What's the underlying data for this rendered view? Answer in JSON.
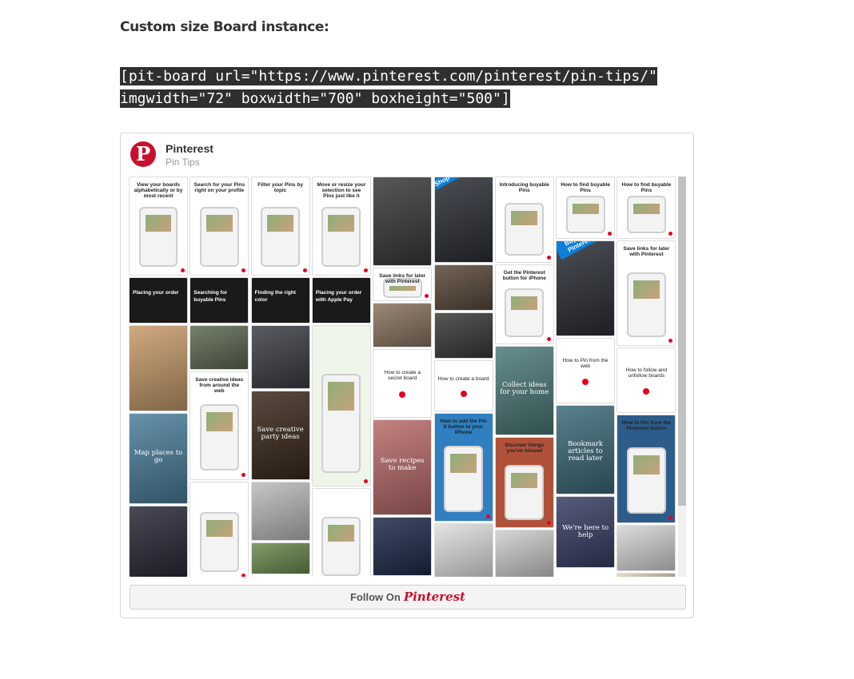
{
  "heading": "Custom size Board instance:",
  "shortcode": {
    "line1": "[pit-board url=\"https://www.pinterest.com/pinterest/pin-tips/\"",
    "line2": "imgwidth=\"72\" boxwidth=\"700\" boxheight=\"500\"]"
  },
  "board": {
    "logo_glyph": "P",
    "owner": "Pinterest",
    "name": "Pin Tips",
    "follow_prefix": "Follow On",
    "follow_brand": "Pinterest",
    "brand_color": "#c8102e"
  },
  "pins": [
    {
      "col": 0,
      "caption": "View your boards alphabetically or by most recent",
      "style": "phone",
      "bg": "#ffffff"
    },
    {
      "col": 0,
      "caption": "Placing your order",
      "style": "dark",
      "bg": "#1a1a1a"
    },
    {
      "col": 0,
      "caption": "",
      "style": "photo",
      "bg": "#c79b6a"
    },
    {
      "col": 0,
      "caption": "Map places to go",
      "style": "overlay",
      "bg": "#4b7f9c"
    },
    {
      "col": 0,
      "caption": "",
      "style": "photo",
      "bg": "#2a2a3a"
    },
    {
      "col": 1,
      "caption": "Search for your Pins right on your profile",
      "style": "phone",
      "bg": "#ffffff"
    },
    {
      "col": 1,
      "caption": "Searching for buyable Pins",
      "style": "dark",
      "bg": "#1a1a1a"
    },
    {
      "col": 1,
      "caption": "",
      "style": "photo",
      "bg": "#5e6b52"
    },
    {
      "col": 1,
      "caption": "Save creative ideas from around the web",
      "style": "phone",
      "bg": "#ffffff"
    },
    {
      "col": 1,
      "caption": "",
      "style": "phone",
      "bg": "#ffffff"
    },
    {
      "col": 2,
      "caption": "Filter your Pins by topic",
      "style": "phone",
      "bg": "#ffffff"
    },
    {
      "col": 2,
      "caption": "Finding the right color",
      "style": "dark",
      "bg": "#1a1a1a"
    },
    {
      "col": 2,
      "caption": "",
      "style": "photo",
      "bg": "#3c3f45"
    },
    {
      "col": 2,
      "caption": "Save creative party ideas",
      "style": "overlay",
      "bg": "#3b2a1d"
    },
    {
      "col": 2,
      "caption": "",
      "style": "photo",
      "bg": "#bcbcbc"
    },
    {
      "col": 2,
      "caption": "",
      "style": "photo",
      "bg": "#6b8c4f"
    },
    {
      "col": 3,
      "caption": "Move or resize your selection to see Pins just like it",
      "style": "phone",
      "bg": "#ffffff"
    },
    {
      "col": 3,
      "caption": "Placing your order with Apple Pay",
      "style": "dark",
      "bg": "#1a1a1a"
    },
    {
      "col": 3,
      "caption": "",
      "style": "phone",
      "bg": "#f0f5ea"
    },
    {
      "col": 3,
      "caption": "",
      "style": "phone",
      "bg": "#ffffff"
    },
    {
      "col": 4,
      "caption": "",
      "style": "photo",
      "bg": "#3a3a3a"
    },
    {
      "col": 4,
      "caption": "Save links for later with Pinterest",
      "style": "phone",
      "bg": "#ffffff"
    },
    {
      "col": 4,
      "caption": "",
      "style": "photo",
      "bg": "#8a7560"
    },
    {
      "col": 4,
      "caption": "How to create a secret board",
      "style": "badge",
      "bg": "#ffffff"
    },
    {
      "col": 4,
      "caption": "Save recipes to make",
      "style": "overlay",
      "bg": "#b86b6b"
    },
    {
      "col": 4,
      "caption": "",
      "style": "photo",
      "bg": "#1f2b4a"
    },
    {
      "col": 5,
      "caption": "Shop our picks",
      "style": "ribbon",
      "bg": "#2b2f36"
    },
    {
      "col": 5,
      "caption": "",
      "style": "photo",
      "bg": "#5a4a3a"
    },
    {
      "col": 5,
      "caption": "",
      "style": "photo",
      "bg": "#3a3a3a"
    },
    {
      "col": 5,
      "caption": "How to create a board",
      "style": "badge",
      "bg": "#ffffff"
    },
    {
      "col": 5,
      "caption": "How to add the Pin It button to your iPhone",
      "style": "phone",
      "bg": "#2f7fc1"
    },
    {
      "col": 5,
      "caption": "",
      "style": "photo",
      "bg": "#e0e0e0"
    },
    {
      "col": 6,
      "caption": "Introducing buyable Pins",
      "style": "phone",
      "bg": "#ffffff"
    },
    {
      "col": 6,
      "caption": "Get the Pinterest button for iPhone",
      "style": "phone",
      "bg": "#ffffff"
    },
    {
      "col": 6,
      "caption": "Collect ideas for your home",
      "style": "overlay",
      "bg": "#4d7a7a"
    },
    {
      "col": 6,
      "caption": "Discover things you've missed",
      "style": "phone",
      "bg": "#b0523a"
    },
    {
      "col": 6,
      "caption": "",
      "style": "photo",
      "bg": "#cfcfcf"
    },
    {
      "col": 7,
      "caption": "How to find buyable Pins",
      "style": "phone",
      "bg": "#ffffff"
    },
    {
      "col": 7,
      "caption": "Buy it on Pinterest",
      "style": "ribbon",
      "bg": "#2b2f36"
    },
    {
      "col": 7,
      "caption": "How to Pin from the web",
      "style": "badge",
      "bg": "#ffffff"
    },
    {
      "col": 7,
      "caption": "Bookmark articles to read later",
      "style": "overlay",
      "bg": "#3d6b7a"
    },
    {
      "col": 7,
      "caption": "We're here to help",
      "style": "overlay",
      "bg": "#3a3f66"
    },
    {
      "col": 8,
      "caption": "How to find buyable Pins",
      "style": "phone",
      "bg": "#ffffff"
    },
    {
      "col": 8,
      "caption": "Save links for later with Pinterest",
      "style": "phone",
      "bg": "#ffffff"
    },
    {
      "col": 8,
      "caption": "How to follow and unfollow boards",
      "style": "badge",
      "bg": "#ffffff"
    },
    {
      "col": 8,
      "caption": "How to Pin from the Pinterest button",
      "style": "phone",
      "bg": "#2e5c8a"
    },
    {
      "col": 8,
      "caption": "",
      "style": "photo",
      "bg": "#d7d7d7"
    },
    {
      "col": 8,
      "caption": "",
      "style": "photo",
      "bg": "#e5d6c0"
    }
  ]
}
